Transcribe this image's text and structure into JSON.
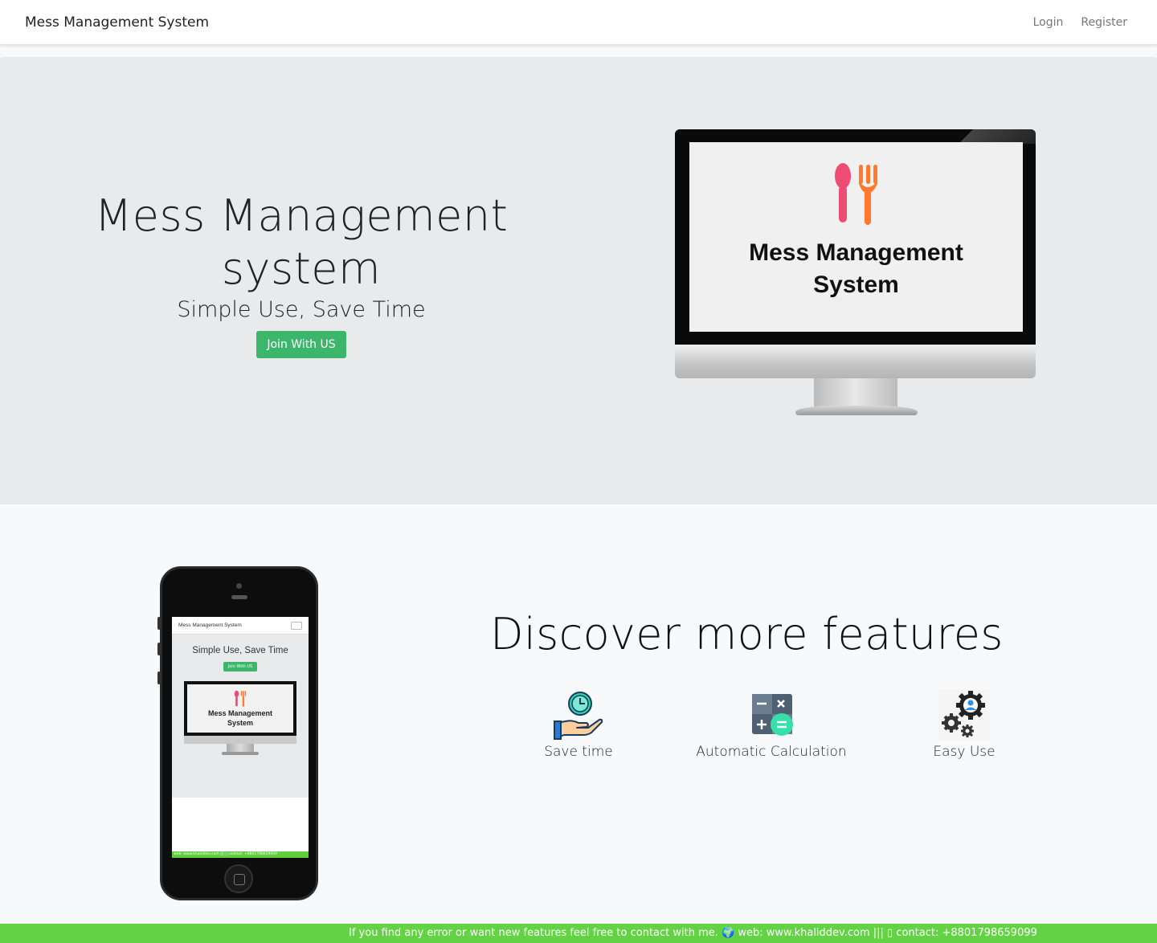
{
  "navbar": {
    "brand": "Mess Management System",
    "login": "Login",
    "register": "Register"
  },
  "hero": {
    "title_line1": "Mess Management",
    "title_line2": "system",
    "subtitle": "Simple Use, Save Time",
    "button": "Join With US",
    "monitor_title_line1": "Mess Management",
    "monitor_title_line2": "System"
  },
  "phone": {
    "nav_brand": "Mess Management System",
    "subtitle": "Simple Use, Save Time",
    "button": "Join With US",
    "monitor_title_line1": "Mess Management",
    "monitor_title_line2": "System",
    "footer": "web: www.khaliddev.com ||| ▯ contact: +8801798659099"
  },
  "features": {
    "heading": "Discover more features",
    "items": [
      {
        "label": "Save time",
        "icon": "clock-hand-icon"
      },
      {
        "label": "Automatic Calculation",
        "icon": "calculator-icon"
      },
      {
        "label": "Easy Use",
        "icon": "gears-user-icon"
      }
    ]
  },
  "footer": {
    "text": "If you find any error or want new features feel free to contact with me. 🌍 web: www.khaliddev.com ||| ▯ contact: +8801798659099"
  },
  "colors": {
    "primary_button": "#3cb66a",
    "footer_bg": "#63d245",
    "hero_bg": "#e8eaec"
  }
}
